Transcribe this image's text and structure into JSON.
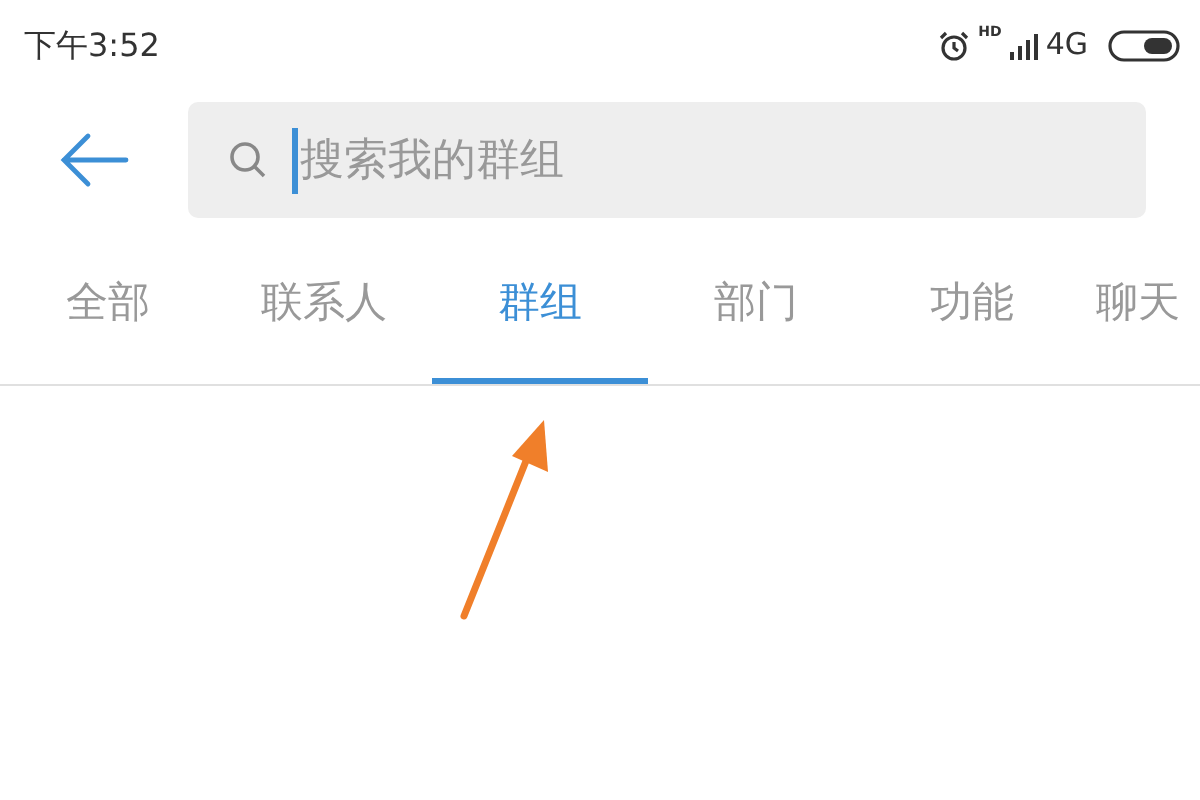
{
  "status_bar": {
    "time": "下午3:52",
    "hd": "HD",
    "network": "4G"
  },
  "search": {
    "placeholder": "搜索我的群组"
  },
  "tabs": [
    {
      "label": "全部",
      "selected": false
    },
    {
      "label": "联系人",
      "selected": false
    },
    {
      "label": "群组",
      "selected": true
    },
    {
      "label": "部门",
      "selected": false
    },
    {
      "label": "功能",
      "selected": false
    },
    {
      "label": "聊天",
      "selected": false
    }
  ]
}
